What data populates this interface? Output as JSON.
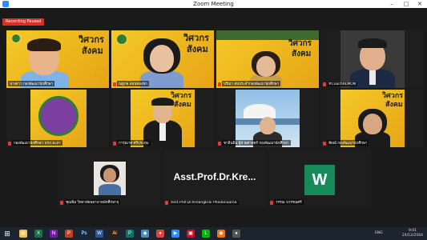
{
  "window": {
    "title": "Zoom Meeting",
    "minimize": "–",
    "maximize": "□",
    "close": "✕"
  },
  "recording_badge": "Recording Paused",
  "banner": {
    "line1": "วิศวกร",
    "line2": "สังคม"
  },
  "participants": [
    {
      "name": "นางสาว กองพัฒนานักศึกษา",
      "muted": false
    },
    {
      "name": "ณฐภล อ่อนทองพัก",
      "muted": true
    },
    {
      "name": "ปรีณา สมประจำกองพัฒนานักศึกษา",
      "muted": true
    },
    {
      "name": "#CoachALMON",
      "muted": true
    },
    {
      "name": "กองพัฒนานักศึกษา มรภ.ยะลา",
      "muted": true
    },
    {
      "name": "การุณาศ ศรีประทุม",
      "muted": true
    },
    {
      "name": "ชาลินอิน ผู้ช่วยศาสตร์ กองพัฒนานักศึกษา",
      "muted": true
    },
    {
      "name": "ชัยณ์ กองพัฒนานักศึกษา",
      "muted": true
    },
    {
      "name": "ชุณพิล วิทยาลัยพยาบาลนักศึกษาจุ",
      "muted": true
    },
    {
      "name": "Asst.Prof.Dr.Kreangkrai Phodonaaroa",
      "muted": true,
      "display_text": "Asst.Prof.Dr.Kre..."
    },
    {
      "name": "วรรณ ปวรรณศรี",
      "muted": true,
      "display_text": "W"
    }
  ],
  "taskbar": {
    "start": "⊞",
    "apps": [
      {
        "name": "file-explorer",
        "glyph": "▤",
        "color": "#f2c14e"
      },
      {
        "name": "excel",
        "glyph": "X",
        "color": "#1d7044"
      },
      {
        "name": "onenote",
        "glyph": "N",
        "color": "#7719aa"
      },
      {
        "name": "powerpoint",
        "glyph": "P",
        "color": "#c43e1c"
      },
      {
        "name": "photoshop",
        "glyph": "Ps",
        "color": "#0a2a4a"
      },
      {
        "name": "word",
        "glyph": "W",
        "color": "#2b579a"
      },
      {
        "name": "illustrator",
        "glyph": "Ai",
        "color": "#3a1e00"
      },
      {
        "name": "publisher",
        "glyph": "P",
        "color": "#077568"
      },
      {
        "name": "sticky-notes",
        "glyph": "◆",
        "color": "#4b8bbe"
      },
      {
        "name": "chrome",
        "glyph": "●",
        "color": "#db4437"
      },
      {
        "name": "zoom",
        "glyph": "▶",
        "color": "#2d8cff"
      },
      {
        "name": "video-app",
        "glyph": "▣",
        "color": "#c8102e"
      },
      {
        "name": "line",
        "glyph": "L",
        "color": "#00b900"
      },
      {
        "name": "media",
        "glyph": "◉",
        "color": "#e8731a"
      },
      {
        "name": "camera",
        "glyph": "●",
        "color": "#555555"
      }
    ],
    "language": "ENG",
    "time": "9:01",
    "date": "24/12/2564"
  }
}
